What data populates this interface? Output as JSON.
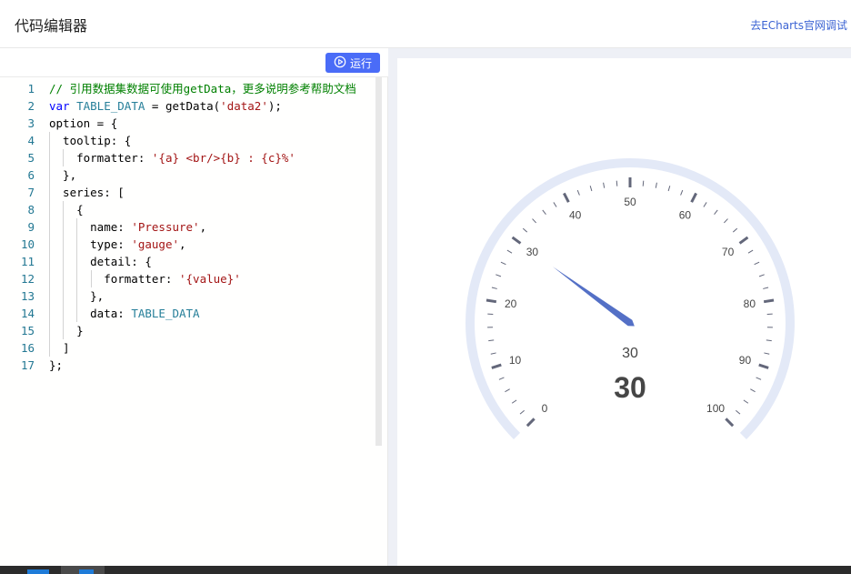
{
  "header": {
    "title": "代码编辑器",
    "link": "去ECharts官网调试"
  },
  "toolbar": {
    "run_label": "运行",
    "run_icon": "play-circle-icon"
  },
  "code": [
    {
      "n": "1",
      "parts": [
        {
          "t": "// 引用数据集数据可使用getData，更多说明参考帮助文档",
          "c": "cm"
        }
      ]
    },
    {
      "n": "2",
      "parts": [
        {
          "t": "var",
          "c": "kw"
        },
        {
          "t": " "
        },
        {
          "t": "TABLE_DATA",
          "c": "var"
        },
        {
          "t": " = getData("
        },
        {
          "t": "'data2'",
          "c": "str"
        },
        {
          "t": ");"
        }
      ]
    },
    {
      "n": "3",
      "parts": [
        {
          "t": "option = {"
        }
      ]
    },
    {
      "n": "4",
      "parts": [
        {
          "t": "  tooltip: {"
        }
      ]
    },
    {
      "n": "5",
      "parts": [
        {
          "t": "    formatter: "
        },
        {
          "t": "'{a} <br/>{b} : {c}%'",
          "c": "str"
        }
      ]
    },
    {
      "n": "6",
      "parts": [
        {
          "t": "  },"
        }
      ]
    },
    {
      "n": "7",
      "parts": [
        {
          "t": "  series: ["
        }
      ]
    },
    {
      "n": "8",
      "parts": [
        {
          "t": "    {"
        }
      ]
    },
    {
      "n": "9",
      "parts": [
        {
          "t": "      name: "
        },
        {
          "t": "'Pressure'",
          "c": "str"
        },
        {
          "t": ","
        }
      ]
    },
    {
      "n": "10",
      "parts": [
        {
          "t": "      type: "
        },
        {
          "t": "'gauge'",
          "c": "str"
        },
        {
          "t": ","
        }
      ]
    },
    {
      "n": "11",
      "parts": [
        {
          "t": "      detail: {"
        }
      ]
    },
    {
      "n": "12",
      "parts": [
        {
          "t": "        formatter: "
        },
        {
          "t": "'{value}'",
          "c": "str"
        }
      ]
    },
    {
      "n": "13",
      "parts": [
        {
          "t": "      },"
        }
      ]
    },
    {
      "n": "14",
      "parts": [
        {
          "t": "      data: "
        },
        {
          "t": "TABLE_DATA",
          "c": "var"
        }
      ]
    },
    {
      "n": "15",
      "parts": [
        {
          "t": "    }"
        }
      ]
    },
    {
      "n": "16",
      "parts": [
        {
          "t": "  ]"
        }
      ]
    },
    {
      "n": "17",
      "parts": [
        {
          "t": "};"
        }
      ]
    }
  ],
  "gauge": {
    "min": 0,
    "max": 100,
    "value": 30,
    "name_label": "30",
    "detail_label": "30",
    "tick_labels": [
      "0",
      "10",
      "20",
      "30",
      "40",
      "50",
      "60",
      "70",
      "80",
      "90",
      "100"
    ],
    "colors": {
      "axis": "#e3e9f7",
      "needle": "#5470c6",
      "tick": "#63677a",
      "text": "#464646"
    }
  }
}
